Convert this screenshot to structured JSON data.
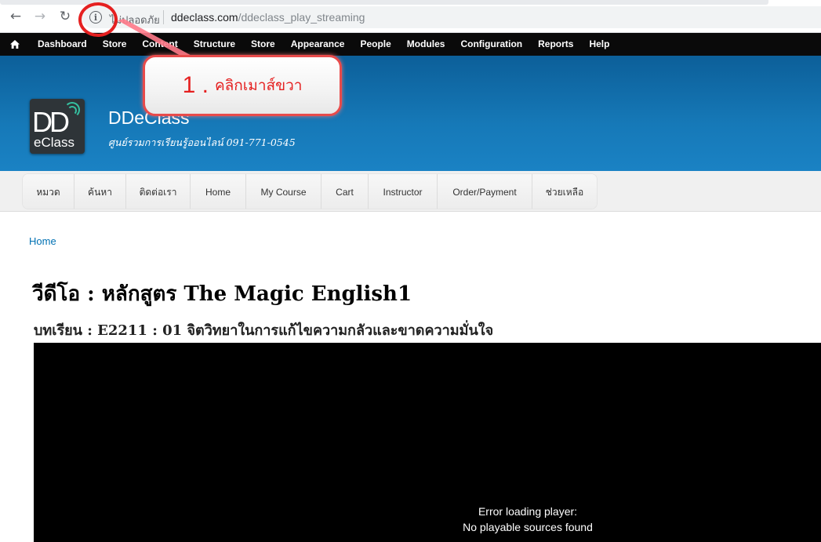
{
  "browser": {
    "security_label": "ไม่ปลอดภัย",
    "url_domain": "ddeclass.com",
    "url_path": "/ddeclass_play_streaming",
    "back_icon": "arrow-left-icon",
    "forward_icon": "arrow-right-icon",
    "reload_icon": "reload-icon",
    "info_icon": "info-icon"
  },
  "admin_toolbar": {
    "items": [
      "Dashboard",
      "Store",
      "Content",
      "Structure",
      "Store",
      "Appearance",
      "People",
      "Modules",
      "Configuration",
      "Reports",
      "Help"
    ]
  },
  "site": {
    "logo_top": "DD",
    "logo_bottom": "eClass",
    "name": "DDeClass",
    "slogan": "ศูนย์รวมการเรียนรู้ออนไลน์ 091-771-0545"
  },
  "main_nav": {
    "items": [
      "หมวด",
      "ค้นหา",
      "ติดต่อเรา",
      "Home",
      "My Course",
      "Cart",
      "Instructor",
      "Order/Payment",
      "ช่วยเหลือ"
    ]
  },
  "breadcrumb": "Home",
  "page": {
    "title": "วีดีโอ : หลักสูตร The Magic English1",
    "lesson": "บทเรียน : E2211 : 01 จิตวิทยาในการแก้ไขความกลัวและขาดความมั่นใจ"
  },
  "player": {
    "error_line1": "Error loading player:",
    "error_line2": "No playable sources found"
  },
  "annotation": {
    "number": "1 .",
    "text": "คลิกเมาส์ขวา",
    "color": "#e52020"
  }
}
